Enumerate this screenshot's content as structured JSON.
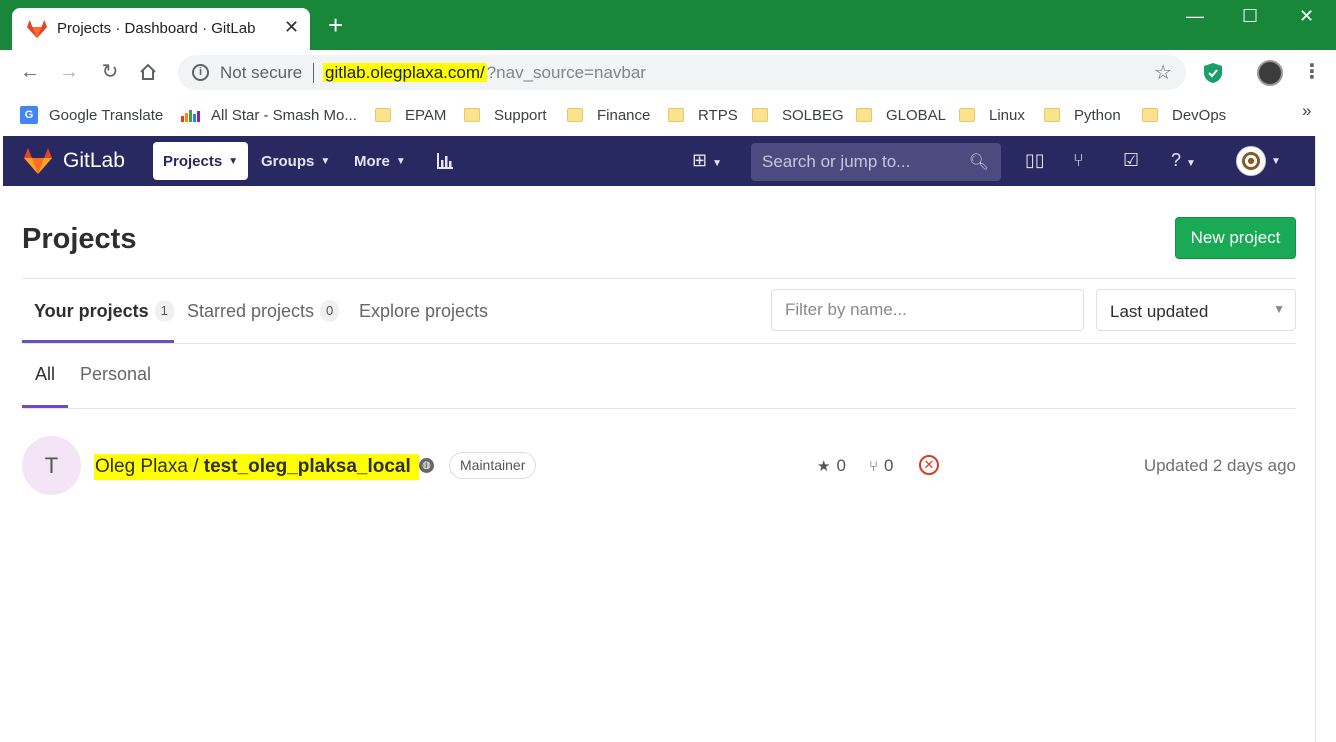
{
  "browser": {
    "tab": {
      "title": "Projects · Dashboard · GitLab",
      "close": "✕"
    },
    "new_tab": "+",
    "window_controls": {
      "minimize": "—",
      "maximize": "☐",
      "close": "✕"
    },
    "omnibox": {
      "security_label": "Not secure",
      "url_host": "gitlab.olegplaxa.com/",
      "url_rest": "?nav_source=navbar"
    },
    "icons": [
      "back-arrow-icon",
      "forward-arrow-icon",
      "reload-icon",
      "home-icon",
      "info-icon",
      "star-icon",
      "shield-extension-icon",
      "profile-avatar",
      "menu-dots-icon"
    ]
  },
  "bookmarks": {
    "items": [
      {
        "label": "Google Translate",
        "icon": "google-translate-icon"
      },
      {
        "label": "All Star - Smash Mo...",
        "icon": "bars-icon"
      },
      {
        "label": "EPAM",
        "icon": "folder-icon"
      },
      {
        "label": "Support",
        "icon": "folder-icon"
      },
      {
        "label": "Finance",
        "icon": "folder-icon"
      },
      {
        "label": "RTPS",
        "icon": "folder-icon"
      },
      {
        "label": "SOLBEG",
        "icon": "folder-icon"
      },
      {
        "label": "GLOBAL",
        "icon": "folder-icon"
      },
      {
        "label": "Linux",
        "icon": "folder-icon"
      },
      {
        "label": "Python",
        "icon": "folder-icon"
      },
      {
        "label": "DevOps",
        "icon": "folder-icon"
      }
    ],
    "overflow": "»"
  },
  "gitlab_nav": {
    "brand": "GitLab",
    "menus": [
      {
        "label": "Projects",
        "active": true
      },
      {
        "label": "Groups",
        "active": false
      },
      {
        "label": "More",
        "active": false
      }
    ],
    "search_placeholder": "Search or jump to...",
    "colors": {
      "navbar": "#292961",
      "accent": "#6b4fbb",
      "success": "#1aaa55"
    }
  },
  "page": {
    "title": "Projects",
    "new_project_label": "New project",
    "tabs": [
      {
        "label": "Your projects",
        "count": "1",
        "active": true
      },
      {
        "label": "Starred projects",
        "count": "0",
        "active": false
      },
      {
        "label": "Explore projects",
        "active": false
      }
    ],
    "filter_placeholder": "Filter by name...",
    "sort_selected": "Last updated",
    "subtabs": [
      {
        "label": "All",
        "active": true
      },
      {
        "label": "Personal",
        "active": false
      }
    ]
  },
  "projects": [
    {
      "avatar_letter": "T",
      "namespace": "Oleg Plaxa / ",
      "name": "test_oleg_plaksa_local",
      "role": "Maintainer",
      "stars": "0",
      "forks": "0",
      "pipeline_status": "failed",
      "updated": "Updated 2 days ago"
    }
  ]
}
